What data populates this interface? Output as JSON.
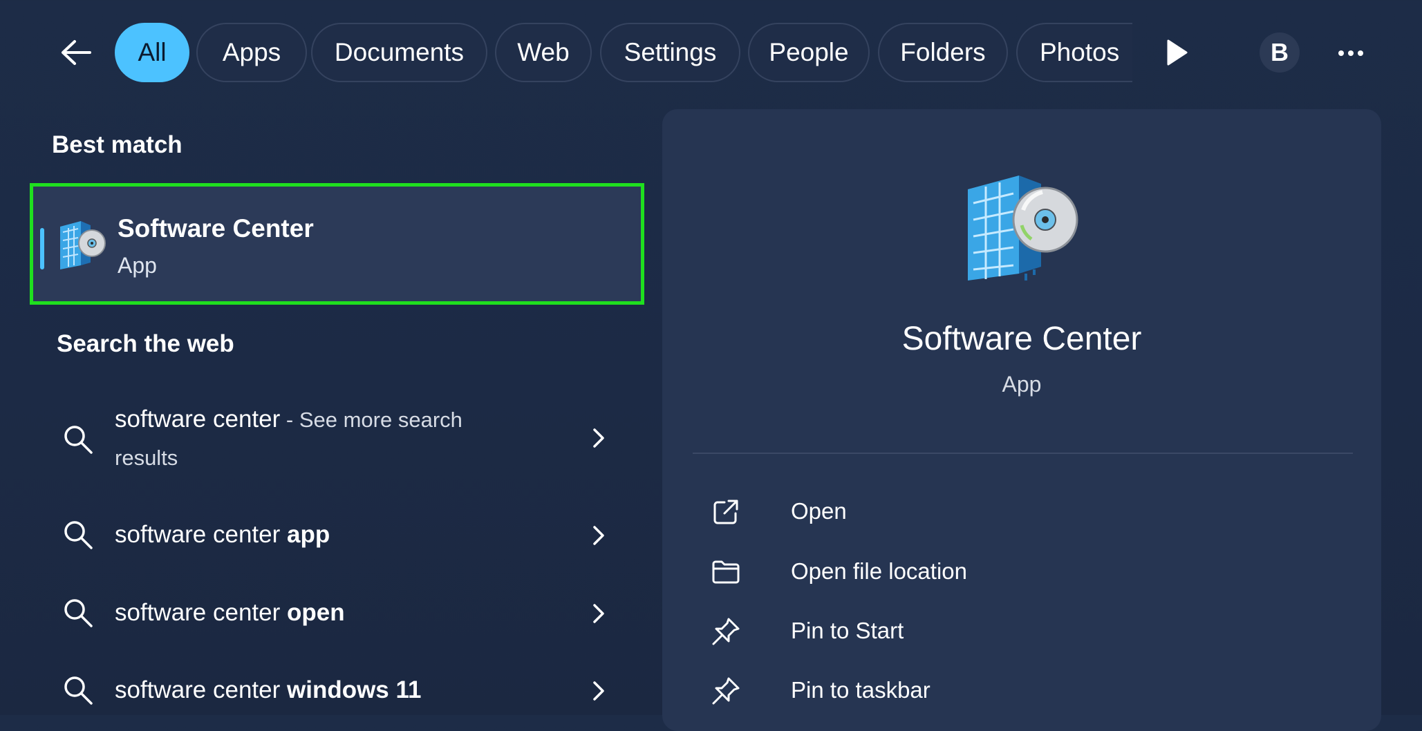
{
  "filters": {
    "tabs": [
      {
        "label": "All",
        "active": true
      },
      {
        "label": "Apps"
      },
      {
        "label": "Documents"
      },
      {
        "label": "Web"
      },
      {
        "label": "Settings"
      },
      {
        "label": "People"
      },
      {
        "label": "Folders"
      },
      {
        "label": "Photos"
      }
    ],
    "avatar_letter": "B"
  },
  "best_match": {
    "heading": "Best match",
    "title": "Software Center",
    "subtitle": "App",
    "icon": "software-center-icon",
    "highlight_color": "#1fe01f"
  },
  "web": {
    "heading": "Search the web",
    "items": [
      {
        "query": "software center",
        "suffix": " - See more search",
        "suffix2": "results"
      },
      {
        "prefix": "software center ",
        "bold": "app"
      },
      {
        "prefix": "software center ",
        "bold": "open"
      },
      {
        "prefix": "software center ",
        "bold": "windows 11"
      }
    ]
  },
  "details": {
    "title": "Software Center",
    "subtitle": "App",
    "actions": [
      {
        "label": "Open",
        "icon": "open-external-icon"
      },
      {
        "label": "Open file location",
        "icon": "folder-icon"
      },
      {
        "label": "Pin to Start",
        "icon": "pin-icon"
      },
      {
        "label": "Pin to taskbar",
        "icon": "pin-icon"
      }
    ]
  },
  "colors": {
    "accent": "#4cc2ff",
    "background": "#1c2a45",
    "panel": "#263552"
  }
}
